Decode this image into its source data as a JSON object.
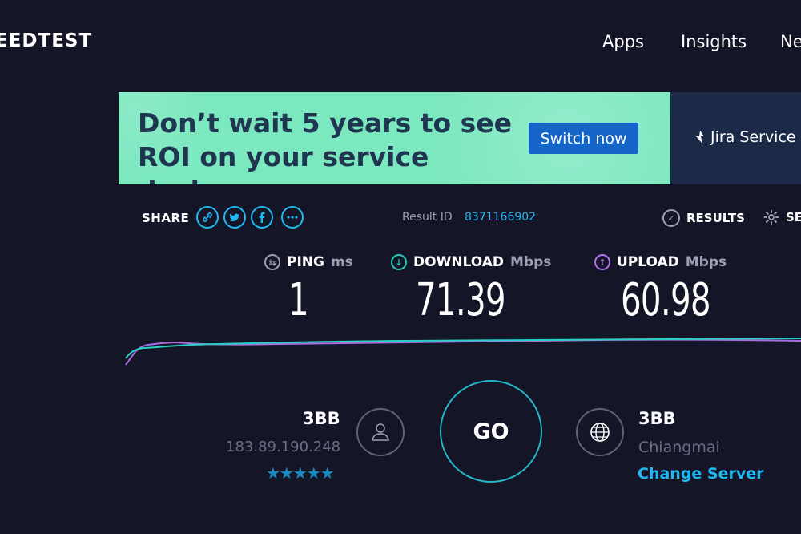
{
  "header": {
    "logo_text": "EEDTEST",
    "nav": [
      "Apps",
      "Insights",
      "Ne"
    ]
  },
  "ad": {
    "headline_line1": "Don’t wait 5 years to see",
    "headline_line2": "ROI on your service desk.",
    "cta": "Switch now",
    "brand": "Jira Service",
    "bg_color": "#7ce8c0",
    "cta_color": "#1565c8"
  },
  "toolbar": {
    "share_label": "SHARE",
    "share_icons": [
      "link-icon",
      "twitter-icon",
      "facebook-icon",
      "more-icon"
    ],
    "result_label": "Result ID",
    "result_id": "8371166902",
    "results_label": "RESULTS",
    "settings_label": "SE"
  },
  "metrics": {
    "ping": {
      "label": "PING",
      "unit": "ms",
      "value": "1",
      "color": "#9a9fb4"
    },
    "download": {
      "label": "DOWNLOAD",
      "unit": "Mbps",
      "value": "71.39",
      "color": "#25c8b8"
    },
    "upload": {
      "label": "UPLOAD",
      "unit": "Mbps",
      "value": "60.98",
      "color": "#b66ee8"
    }
  },
  "isp": {
    "name": "3BB",
    "ip": "183.89.190.248",
    "stars": "★★★★★"
  },
  "go_label": "GO",
  "server": {
    "name": "3BB",
    "city": "Chiangmai",
    "change_label": "Change Server"
  }
}
